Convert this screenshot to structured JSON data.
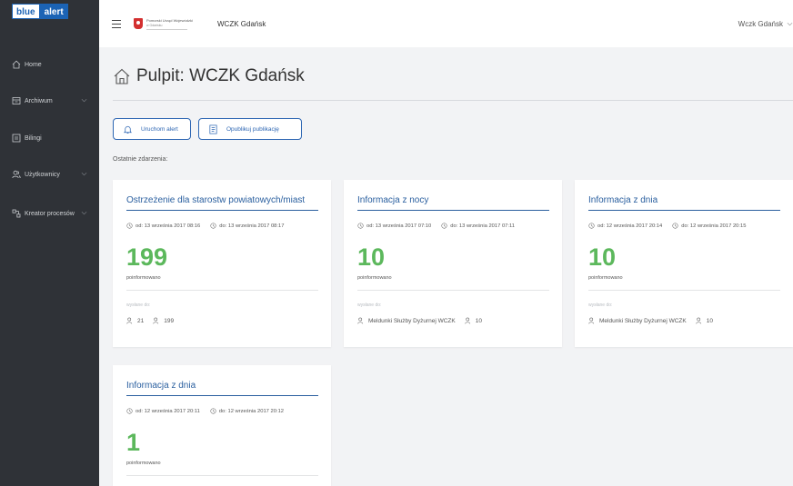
{
  "logo": {
    "blue": "blue",
    "alert": "alert"
  },
  "sidebar": {
    "items": [
      {
        "label": "Home",
        "icon": "home-icon",
        "chevron": false
      },
      {
        "label": "Archiwum",
        "icon": "archive-icon",
        "chevron": true
      },
      {
        "label": "Bilingi",
        "icon": "billing-icon",
        "chevron": false
      },
      {
        "label": "Użytkownicy",
        "icon": "users-icon",
        "chevron": true
      },
      {
        "label": "Kreator procesów",
        "icon": "process-icon",
        "chevron": true
      }
    ]
  },
  "topbar": {
    "org_line1": "Pomorski Urząd Wojewódzki",
    "org_line2": "w Gdańsku",
    "title": "WCZK Gdańsk",
    "user": "Wczk Gdańsk"
  },
  "page": {
    "title": "Pulpit: WCZK Gdańsk",
    "btn_alert": "Uruchom alert",
    "btn_publish": "Opublikuj publikację",
    "recent_label": "Ostatnie zdarzenia:"
  },
  "cards": [
    {
      "title": "Ostrzeżenie dla starostw powiatowych/miast",
      "from": "od: 13 września 2017 08:16",
      "to": "do: 13 września 2017 08:17",
      "count": "199",
      "informed": "poinformowano",
      "sent_label": "wysłane do:",
      "recipient_a": "21",
      "recipient_b": "199"
    },
    {
      "title": "Informacja z nocy",
      "from": "od: 13 września 2017 07:10",
      "to": "do: 13 września 2017 07:11",
      "count": "10",
      "informed": "poinformowano",
      "sent_label": "wysłane do:",
      "recipient_a": "Meldunki Służby Dyżurnej WCZK",
      "recipient_b": "10"
    },
    {
      "title": "Informacja z dnia",
      "from": "od: 12 września 2017 20:14",
      "to": "do: 12 września 2017 20:15",
      "count": "10",
      "informed": "poinformowano",
      "sent_label": "wysłane do:",
      "recipient_a": "Meldunki Służby Dyżurnej WCZK",
      "recipient_b": "10"
    },
    {
      "title": "Informacja z dnia",
      "from": "od: 12 września 2017 20:11",
      "to": "do: 12 września 2017 20:12",
      "count": "1",
      "informed": "poinformowano"
    }
  ],
  "colors": {
    "sidebar_bg": "#2f3237",
    "brand_blue": "#2d66b3",
    "count_green": "#5cb85c"
  }
}
